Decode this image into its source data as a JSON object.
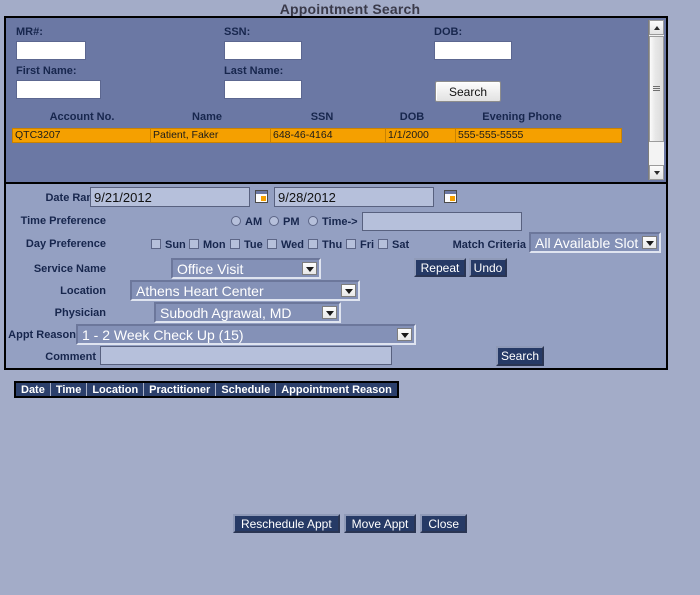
{
  "window": {
    "title": "Appointment Search"
  },
  "colors": {
    "page_background": "#a3acc8",
    "patient_panel": "#6b78a4",
    "criteria_panel": "#94a0c2",
    "label_text": "#17264d",
    "highlight_row": "#f5a000",
    "dark_button": "#263a66",
    "results_header": "#2b3f6b"
  },
  "patient_search": {
    "fields": [
      {
        "label": "MR#:",
        "value": "",
        "name": "mr-number-field"
      },
      {
        "label": "SSN:",
        "value": "",
        "name": "ssn-field"
      },
      {
        "label": "DOB:",
        "value": "",
        "name": "dob-field"
      },
      {
        "label": "First Name:",
        "value": "",
        "name": "first-name-field"
      },
      {
        "label": "Last Name:",
        "value": "",
        "name": "last-name-field"
      }
    ],
    "search_button": "Search",
    "grid": {
      "columns": [
        "Account No.",
        "Name",
        "SSN",
        "DOB",
        "Evening Phone"
      ],
      "rows": [
        {
          "account_no": "QTC3207",
          "name": "Patient, Faker",
          "ssn": "648-46-4164",
          "dob": "1/1/2000",
          "evening_phone": "555-555-5555",
          "selected": true
        }
      ]
    },
    "scrollbar": {
      "up_icon": "scroll-up-arrow-icon",
      "down_icon": "scroll-down-arrow-icon"
    }
  },
  "criteria": {
    "date_range": {
      "label": "Date Range",
      "start": "9/21/2012",
      "end": "9/28/2012",
      "calendar_icon": "calendar-icon"
    },
    "time_preference": {
      "label": "Time Preference",
      "options": [
        "AM",
        "PM",
        "Time->"
      ],
      "selected": "",
      "time_value": ""
    },
    "day_preference": {
      "label": "Day Preference",
      "days": [
        "Sun",
        "Mon",
        "Tue",
        "Wed",
        "Thu",
        "Fri",
        "Sat"
      ],
      "checked": []
    },
    "match_criteria": {
      "label": "Match Criteria",
      "value": "All Available Slots"
    },
    "service_name": {
      "label": "Service Name",
      "value": "Office Visit"
    },
    "location": {
      "label": "Location",
      "value": "Athens Heart Center"
    },
    "physician": {
      "label": "Physician",
      "value": "Subodh Agrawal, MD"
    },
    "appt_reason": {
      "label": "Appt Reason",
      "value": "1 - 2 Week Check Up (15)"
    },
    "comment": {
      "label": "Comment",
      "value": ""
    },
    "repeat_button": "Repeat",
    "undo_button": "Undo",
    "search_button": "Search"
  },
  "results": {
    "columns": [
      "Date",
      "Time",
      "Location",
      "Practitioner",
      "Schedule",
      "Appointment Reason"
    ],
    "rows": []
  },
  "actions": {
    "reschedule": "Reschedule Appt",
    "move": "Move Appt",
    "close": "Close"
  }
}
